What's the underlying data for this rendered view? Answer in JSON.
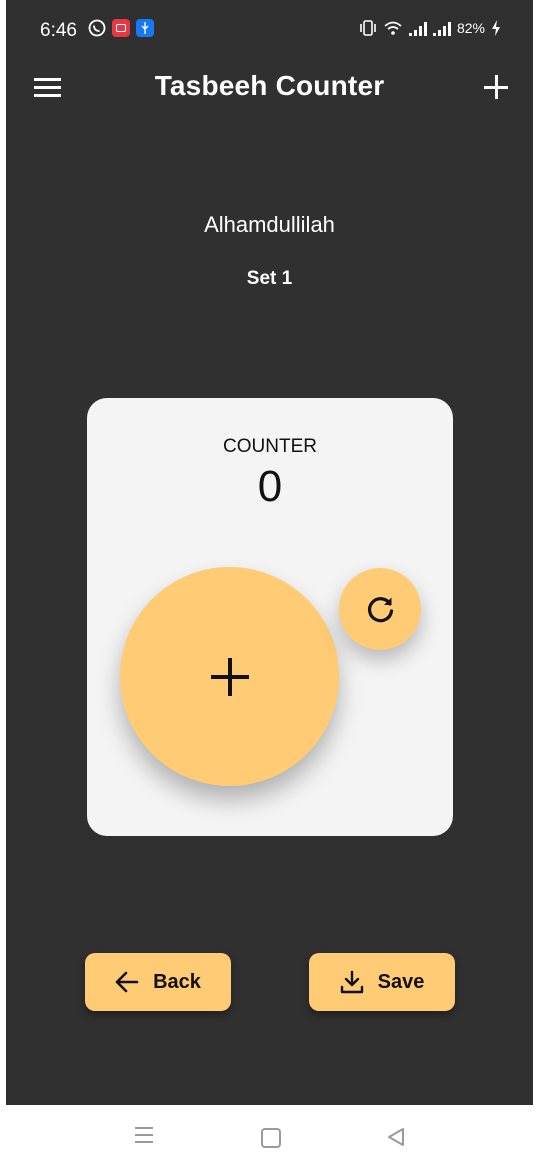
{
  "status_bar": {
    "time": "6:46",
    "battery": "82%"
  },
  "app_bar": {
    "title": "Tasbeeh Counter",
    "menu_icon": "hamburger-menu-icon",
    "add_icon": "plus-icon"
  },
  "dhikr": {
    "name": "Alhamdullilah",
    "set_label": "Set 1"
  },
  "counter": {
    "label": "COUNTER",
    "value": "0",
    "increment_icon": "plus-icon",
    "reset_icon": "refresh-icon"
  },
  "actions": {
    "back_label": "Back",
    "save_label": "Save"
  },
  "colors": {
    "background": "#303030",
    "accent": "#ffcb74",
    "card": "#f4f4f4"
  }
}
